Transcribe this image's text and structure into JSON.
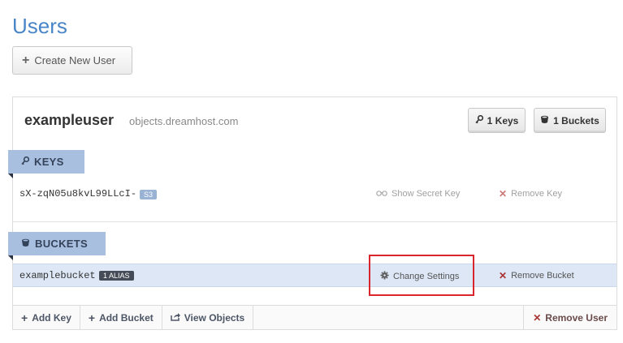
{
  "page": {
    "title": "Users"
  },
  "toolbar": {
    "create_label": "Create New User"
  },
  "user": {
    "name": "exampleuser",
    "host": "objects.dreamhost.com",
    "keys_count_label": "1 Keys",
    "buckets_count_label": "1 Buckets"
  },
  "keys_section": {
    "header": "KEYS",
    "items": [
      {
        "key": "sX-zqN05u8kvL99LLcI-",
        "type": "S3",
        "show_secret": "Show Secret Key",
        "remove": "Remove Key"
      }
    ]
  },
  "buckets_section": {
    "header": "BUCKETS",
    "items": [
      {
        "name": "examplebucket",
        "alias_badge": "1 ALIAS",
        "change_settings": "Change Settings",
        "remove": "Remove Bucket"
      }
    ]
  },
  "footer": {
    "add_key": "Add Key",
    "add_bucket": "Add Bucket",
    "view_objects": "View Objects",
    "remove_user": "Remove User"
  },
  "colors": {
    "accent": "#4a86c7",
    "section_header": "#a9bfe0",
    "highlight": "#d9262c",
    "selected_row": "#dde7f5"
  }
}
